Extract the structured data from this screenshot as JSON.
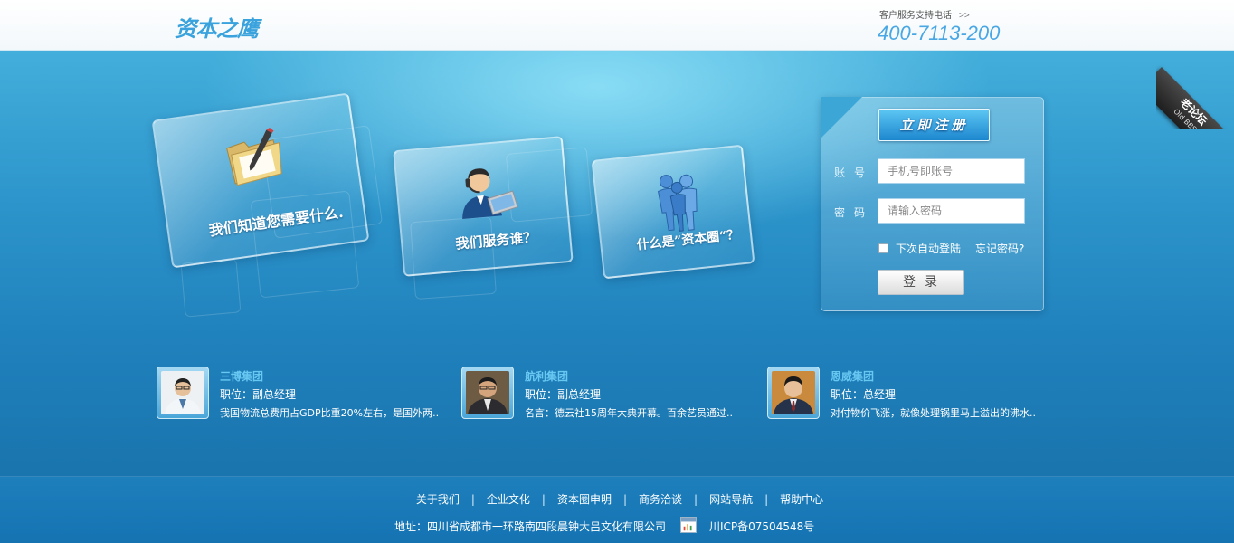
{
  "header": {
    "logo_text": "资本之鹰",
    "hotline_label": "客户服务支持电话",
    "hotline_arrow": ">>",
    "hotline_number": "400-7113-200"
  },
  "corner_ribbon": {
    "label_cn": "老论坛",
    "label_en": "Old BBS"
  },
  "cards": [
    {
      "text": "我们知道您需要什么.",
      "icon": "folder-pen-icon"
    },
    {
      "text": "我们服务谁？",
      "icon": "customer-support-icon"
    },
    {
      "text": "什么是”资本圈“？",
      "icon": "people-group-icon"
    }
  ],
  "login": {
    "register_label": "立即注册",
    "account_label": "账号",
    "account_placeholder": "手机号即账号",
    "password_label": "密码",
    "password_placeholder": "请输入密码",
    "remember_label": "下次自动登陆",
    "forgot_label": "忘记密码?",
    "login_label": "登录"
  },
  "testimonials": [
    {
      "company": "三博集团",
      "position": "职位：副总经理",
      "quote": "我国物流总费用占GDP比重20%左右，是国外两.."
    },
    {
      "company": "航利集团",
      "position": "职位：副总经理",
      "quote": "名言：德云社15周年大典开幕。百余艺员通过.."
    },
    {
      "company": "恩威集团",
      "position": "职位：总经理",
      "quote": "对付物价飞涨，就像处理锅里马上溢出的沸水.."
    }
  ],
  "footer": {
    "nav": [
      "关于我们",
      "企业文化",
      "资本圈申明",
      "商务洽谈",
      "网站导航",
      "帮助中心"
    ],
    "separator": "|",
    "address": "地址：四川省成都市一环路南四段晨钟大吕文化有限公司",
    "icp": "川ICP备07504548号"
  },
  "colors": {
    "accent_blue": "#3aa2dc",
    "company_name": "#69c8f2",
    "footer_bg": "#1573b2"
  }
}
